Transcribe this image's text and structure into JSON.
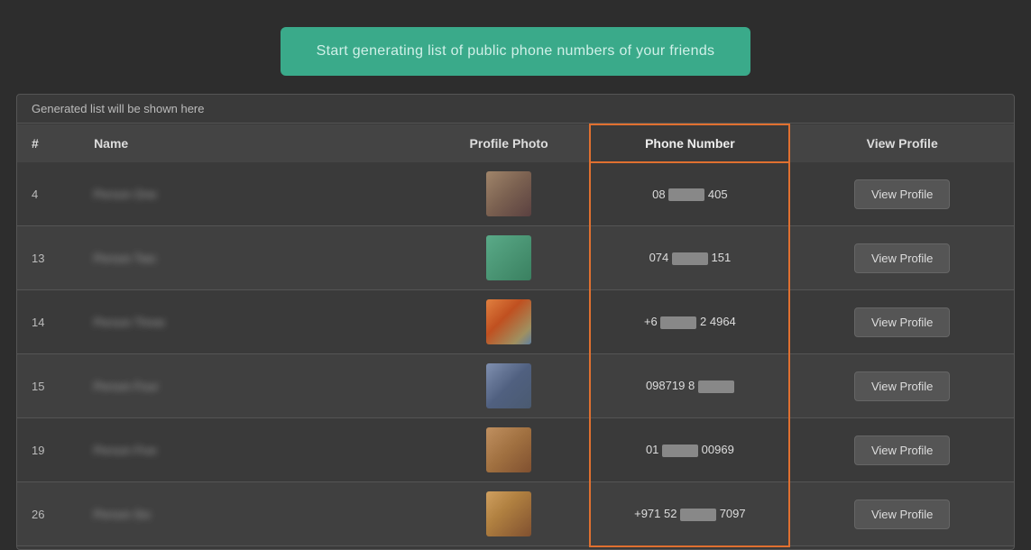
{
  "banner": {
    "label": "Start generating list of public phone numbers of your friends"
  },
  "table": {
    "note": "Generated list will be shown here",
    "columns": {
      "num": "#",
      "name": "Name",
      "photo": "Profile Photo",
      "phone": "Phone Number",
      "viewprofile": "View Profile"
    },
    "rows": [
      {
        "num": "4",
        "name": "Person One",
        "phone_prefix": "08",
        "phone_suffix": "405",
        "photo_class": "photo-row1",
        "view_label": "View Profile"
      },
      {
        "num": "13",
        "name": "Person Two",
        "phone_prefix": "074",
        "phone_suffix": "151",
        "photo_class": "photo-row2",
        "view_label": "View Profile"
      },
      {
        "num": "14",
        "name": "Person Three",
        "phone_prefix": "+6",
        "phone_suffix": "2 4964",
        "photo_class": "photo-row3",
        "view_label": "View Profile"
      },
      {
        "num": "15",
        "name": "Person Four",
        "phone_prefix": "098719 8",
        "phone_suffix": "",
        "photo_class": "photo-row4",
        "view_label": "View Profile"
      },
      {
        "num": "19",
        "name": "Person Five",
        "phone_prefix": "01",
        "phone_suffix": "00969",
        "photo_class": "photo-row5",
        "view_label": "View Profile"
      },
      {
        "num": "26",
        "name": "Person Six",
        "phone_prefix": "+971 52",
        "phone_suffix": "7097",
        "photo_class": "photo-row6",
        "view_label": "View Profile"
      }
    ]
  }
}
